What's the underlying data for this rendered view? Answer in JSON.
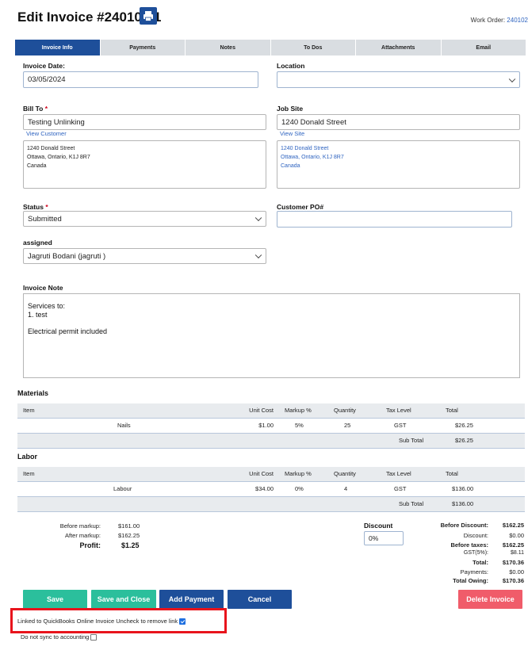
{
  "header": {
    "title": "Edit Invoice #240102-1",
    "work_order_label": "Work Order: ",
    "work_order_value": "240102"
  },
  "tabs": [
    {
      "label": "Invoice Info",
      "active": true
    },
    {
      "label": "Payments"
    },
    {
      "label": "Notes"
    },
    {
      "label": "To Dos"
    },
    {
      "label": "Attachments"
    },
    {
      "label": "Email"
    }
  ],
  "form": {
    "invoice_date_label": "Invoice Date:",
    "invoice_date_value": "03/05/2024",
    "location_label": "Location",
    "location_value": "",
    "bill_to_label": "Bill To",
    "bill_to_value": "Testing Unlinking",
    "view_customer": "View Customer",
    "bill_address": [
      "1240 Donald Street",
      "Ottawa, Ontario, K1J 8R7",
      "Canada"
    ],
    "job_site_label": "Job Site",
    "job_site_value": "1240 Donald Street",
    "view_site": "View Site",
    "site_address": [
      "1240 Donald Street",
      "Ottawa, Ontario, K1J 8R7",
      "Canada"
    ],
    "status_label": "Status",
    "status_value": "Submitted",
    "customer_po_label": "Customer PO#",
    "customer_po_value": "",
    "assigned_label": "assigned",
    "assigned_value": "Jagruti Bodani (jagruti )",
    "invoice_note_label": "Invoice Note",
    "invoice_note_lines": [
      "Services to:",
      "1.  test",
      "",
      "Electrical permit included"
    ],
    "required_mark": "*"
  },
  "materials": {
    "title": "Materials",
    "headers": {
      "item": "Item",
      "unit_cost": "Unit Cost",
      "markup": "Markup %",
      "quantity": "Quantity",
      "tax_level": "Tax Level",
      "total": "Total"
    },
    "rows": [
      {
        "item": "Nails",
        "unit_cost": "$1.00",
        "markup": "5%",
        "quantity": "25",
        "tax_level": "GST",
        "total": "$26.25"
      }
    ],
    "subtotal_label": "Sub Total",
    "subtotal_value": "$26.25"
  },
  "labor": {
    "title": "Labor",
    "headers": {
      "item": "Item",
      "unit_cost": "Unit Cost",
      "markup": "Markup %",
      "quantity": "Quantity",
      "tax_level": "Tax Level",
      "total": "Total"
    },
    "rows": [
      {
        "item": "Labour",
        "unit_cost": "$34.00",
        "markup": "0%",
        "quantity": "4",
        "tax_level": "GST",
        "total": "$136.00"
      }
    ],
    "subtotal_label": "Sub Total",
    "subtotal_value": "$136.00"
  },
  "summary": {
    "before_markup_label": "Before markup:",
    "before_markup_value": "$161.00",
    "after_markup_label": "After markup:",
    "after_markup_value": "$162.25",
    "profit_label": "Profit:",
    "profit_value": "$1.25",
    "discount_label": "Discount",
    "discount_value": "0%"
  },
  "totals": {
    "before_discount_label": "Before Discount:",
    "before_discount_value": "$162.25",
    "discount_label": "Discount:",
    "discount_value": "$0.00",
    "before_taxes_label": "Before taxes:",
    "before_taxes_value": "$162.25",
    "gst_label": "GST(5%):",
    "gst_value": "$8.11",
    "total_label": "Total:",
    "total_value": "$170.36",
    "payments_label": "Payments:",
    "payments_value": "$0.00",
    "owing_label": "Total Owing:",
    "owing_value": "$170.36"
  },
  "buttons": {
    "save": "Save",
    "save_close": "Save and Close",
    "add_payment": "Add Payment",
    "cancel": "Cancel",
    "delete": "Delete Invoice"
  },
  "checkboxes": {
    "qbo_label": "Linked to QuickBooks Online Invoice Uncheck to remove link",
    "qbo_checked": true,
    "nosync_label": "Do not sync to accounting",
    "nosync_checked": false
  },
  "colors": {
    "primary": "#1e4f9a",
    "teal": "#2bbf9c",
    "danger": "#f05c6a",
    "highlight_box": "#e8141c",
    "link": "#2f64c0"
  }
}
